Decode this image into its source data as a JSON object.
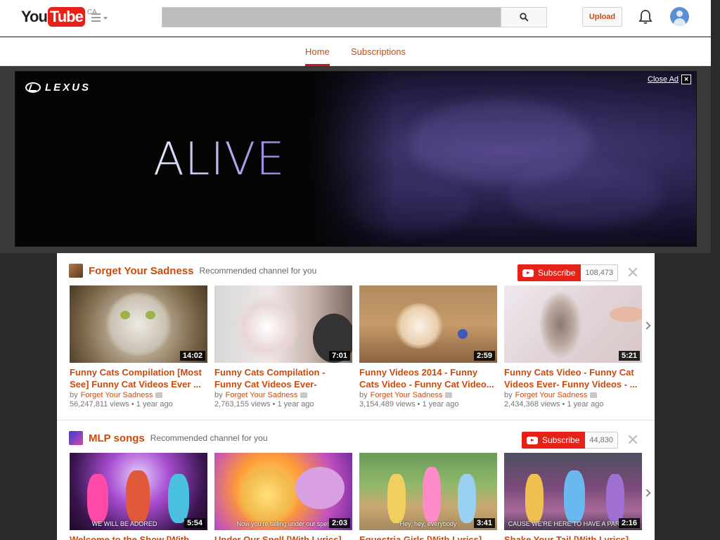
{
  "header": {
    "logo_you": "You",
    "logo_tube": "Tube",
    "region": "CA",
    "upload_label": "Upload"
  },
  "tabs": [
    {
      "label": "Home",
      "active": true
    },
    {
      "label": "Subscriptions",
      "active": false
    }
  ],
  "ad": {
    "brand": "LEXUS",
    "headline": "ALIVE",
    "close_label": "Close Ad",
    "close_icon": "close-icon"
  },
  "shelves": [
    {
      "channel": "Forget Your Sadness",
      "tagline": "Recommended channel for you",
      "subscribe_label": "Subscribe",
      "subscriber_count": "108,473",
      "videos": [
        {
          "title": "Funny Cats Compilation [Most See] Funny Cat Videos Ever  ...",
          "owner": "Forget Your Sadness",
          "views": "56,247,811 views",
          "age": "1 year ago",
          "duration": "14:02"
        },
        {
          "title": "Funny Cats Compilation - Funny Cat Videos Ever- Funny...",
          "owner": "Forget Your Sadness",
          "views": "2,763,155 views",
          "age": "1 year ago",
          "duration": "7:01"
        },
        {
          "title": "Funny Videos 2014 - Funny Cats Video - Funny Cat Video...",
          "owner": "Forget Your Sadness",
          "views": "3,154,489 views",
          "age": "1 year ago",
          "duration": "2:59"
        },
        {
          "title": "Funny Cats Video - Funny Cat Videos Ever- Funny Videos -  ...",
          "owner": "Forget Your Sadness",
          "views": "2,434,368 views",
          "age": "1 year ago",
          "duration": "5:21"
        }
      ]
    },
    {
      "channel": "MLP songs",
      "tagline": "Recommended channel for you",
      "subscribe_label": "Subscribe",
      "subscriber_count": "44,830",
      "videos": [
        {
          "title": "Welcome to the Show [With",
          "duration": "5:54",
          "overlay": "WE WILL BE ADORED"
        },
        {
          "title": "Under Our Spell [With Lyrics] -",
          "duration": "2:03",
          "overlay": "Now you're falling under our spell"
        },
        {
          "title": "Equestria Girls [With Lyrics] -",
          "duration": "3:41",
          "overlay": "Hey, hey, everybody"
        },
        {
          "title": "Shake Your Tail [With Lyrics] -",
          "duration": "2:16",
          "overlay": "CAUSE WE'RE HERE TO HAVE A PARTY TO"
        }
      ]
    }
  ]
}
